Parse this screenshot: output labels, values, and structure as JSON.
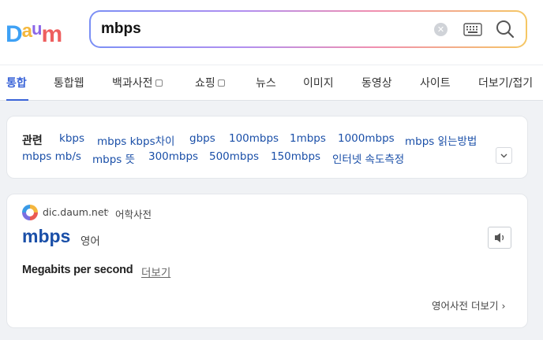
{
  "logo": {
    "letters": [
      "D",
      "a",
      "u",
      "m"
    ],
    "colors": [
      "#3ea1f5",
      "#f5b83d",
      "#8b66e8",
      "#ee5f5f"
    ]
  },
  "search": {
    "value": "mbps",
    "clear_icon": "close-circle-icon",
    "keyboard_icon": "keyboard-icon",
    "search_icon": "magnifier-icon"
  },
  "tabs": [
    {
      "label": "통합",
      "active": true
    },
    {
      "label": "통합웹"
    },
    {
      "label": "백과사전"
    },
    {
      "label": "쇼핑"
    },
    {
      "label": "뉴스"
    },
    {
      "label": "이미지"
    },
    {
      "label": "동영상"
    },
    {
      "label": "사이트"
    },
    {
      "label": "더보기/접기"
    }
  ],
  "related": {
    "title": "관련",
    "keywords": [
      "kbps",
      "mbps kbps차이",
      "gbps",
      "100mbps",
      "1mbps",
      "1000mbps",
      "mbps 읽는방법",
      "mbps mb/s",
      "mbps 뜻",
      "300mbps",
      "500mbps",
      "150mbps",
      "인터넷 속도측정"
    ]
  },
  "dict": {
    "source_domain": "dic.daum.net",
    "breadcrumb_sep": "›",
    "source_category": "어학사전",
    "word": "mbps",
    "language": "영어",
    "meaning": "Megabits per second",
    "more_label": "더보기",
    "dict_more_label": "영어사전 더보기 ›"
  },
  "colors": {
    "accent": "#3a64d8",
    "link": "#1a4fa8"
  }
}
